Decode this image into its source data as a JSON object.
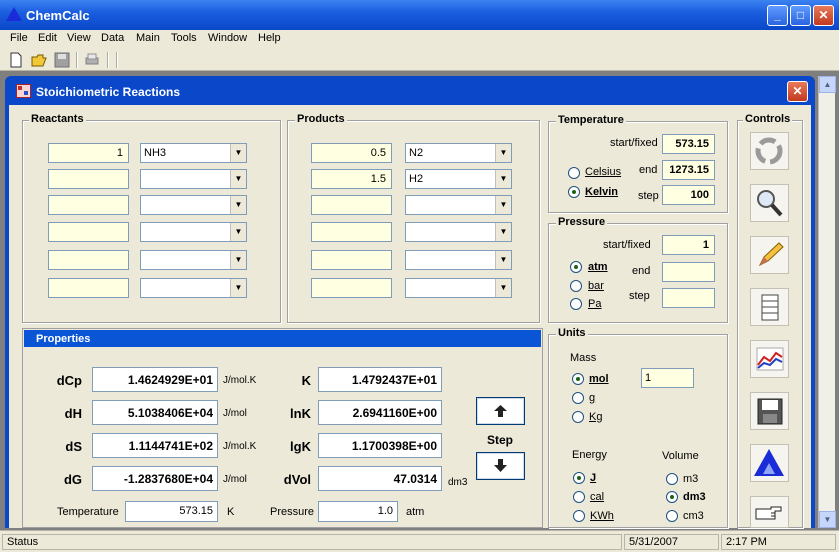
{
  "app": {
    "title": "ChemCalc"
  },
  "menu": [
    "File",
    "Edit",
    "View",
    "Data",
    "Main",
    "Tools",
    "Window",
    "Help"
  ],
  "window": {
    "title": "Stoichiometric Reactions"
  },
  "reactants": {
    "label": "Reactants",
    "rows": [
      {
        "qty": "1",
        "species": "NH3"
      },
      {
        "qty": "",
        "species": ""
      },
      {
        "qty": "",
        "species": ""
      },
      {
        "qty": "",
        "species": ""
      },
      {
        "qty": "",
        "species": ""
      },
      {
        "qty": "",
        "species": ""
      }
    ]
  },
  "products": {
    "label": "Products",
    "rows": [
      {
        "qty": "0.5",
        "species": "N2"
      },
      {
        "qty": "1.5",
        "species": "H2"
      },
      {
        "qty": "",
        "species": ""
      },
      {
        "qty": "",
        "species": ""
      },
      {
        "qty": "",
        "species": ""
      },
      {
        "qty": "",
        "species": ""
      }
    ]
  },
  "temperature": {
    "label": "Temperature",
    "start_label": "start/fixed",
    "start": "573.15",
    "end_label": "end",
    "end": "1273.15",
    "step_label": "step",
    "step": "100",
    "celsius": "Celsius",
    "kelvin": "Kelvin",
    "selected": "kelvin"
  },
  "pressure": {
    "label": "Pressure",
    "start_label": "start/fixed",
    "start": "1",
    "end_label": "end",
    "end": "",
    "step_label": "step",
    "step": "",
    "atm": "atm",
    "bar": "bar",
    "pa": "Pa",
    "selected": "atm"
  },
  "units": {
    "label": "Units",
    "mass_label": "Mass",
    "mol": "mol",
    "g": "g",
    "kg": "Kg",
    "mass_value": "1",
    "mass_selected": "mol",
    "energy_label": "Energy",
    "j": "J",
    "cal": "cal",
    "kwh": "KWh",
    "energy_selected": "J",
    "volume_label": "Volume",
    "m3": "m3",
    "dm3": "dm3",
    "cm3": "cm3",
    "volume_selected": "dm3"
  },
  "controls": {
    "label": "Controls",
    "icons": [
      "recycle-icon",
      "magnifier-icon",
      "pencil-icon",
      "scroll-icon",
      "chart-icon",
      "floppy-icon",
      "chemcalc-logo-icon",
      "hand-pointer-icon"
    ]
  },
  "properties": {
    "header": "Properties",
    "left": [
      {
        "label": "dCp",
        "value": "1.4624929E+01",
        "unit": "J/mol.K"
      },
      {
        "label": "dH",
        "value": "5.1038406E+04",
        "unit": "J/mol"
      },
      {
        "label": "dS",
        "value": "1.1144741E+02",
        "unit": "J/mol.K"
      },
      {
        "label": "dG",
        "value": "-1.2837680E+04",
        "unit": "J/mol"
      }
    ],
    "right": [
      {
        "label": "K",
        "value": "1.4792437E+01",
        "unit": ""
      },
      {
        "label": "lnK",
        "value": "2.6941160E+00",
        "unit": ""
      },
      {
        "label": "lgK",
        "value": "1.1700398E+00",
        "unit": ""
      },
      {
        "label": "dVol",
        "value": "47.0314",
        "unit": "dm3"
      }
    ],
    "step_label": "Step",
    "temperature_label": "Temperature",
    "temperature_value": "573.15",
    "temperature_unit": "K",
    "pressure_label": "Pressure",
    "pressure_value": "1.0",
    "pressure_unit": "atm"
  },
  "status": {
    "text": "Status",
    "date": "5/31/2007",
    "time": "2:17 PM"
  }
}
